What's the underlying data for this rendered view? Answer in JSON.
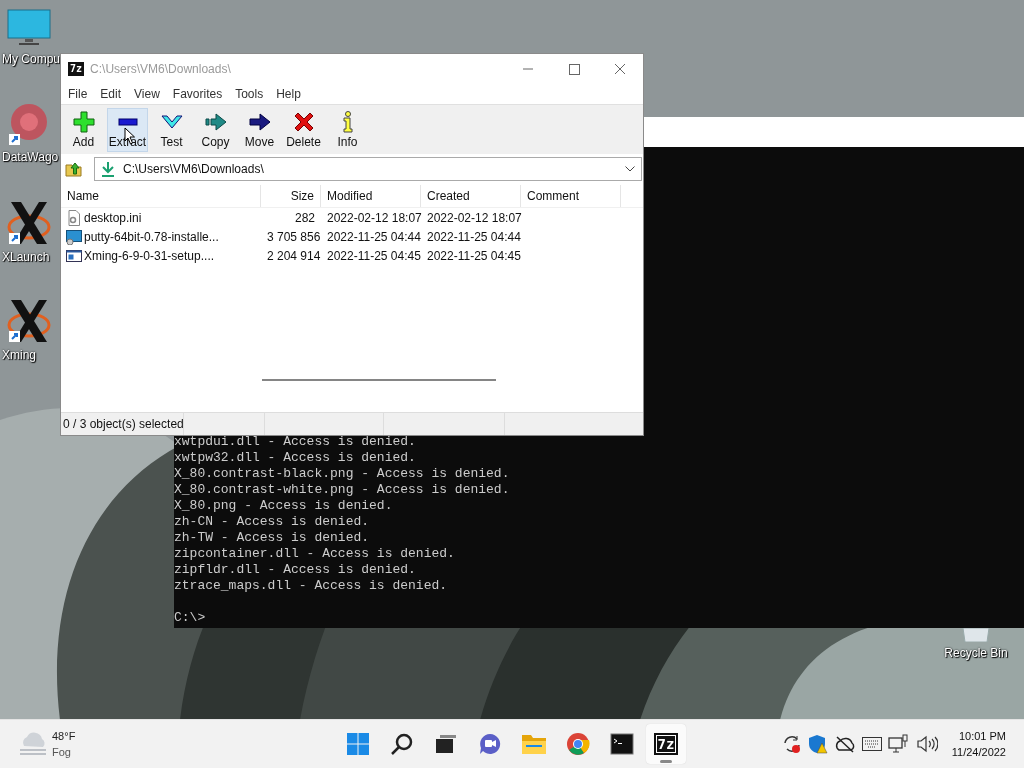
{
  "desktop_icons": [
    {
      "label": "My Compu",
      "kind": "monitor"
    },
    {
      "label": "DataWago",
      "kind": "network"
    },
    {
      "label": "XLaunch",
      "kind": "x"
    },
    {
      "label": "Xming",
      "kind": "x"
    },
    {
      "label": "Recycle Bin",
      "kind": "bin"
    }
  ],
  "console": {
    "lines": [
      "xwtpdui.dll - Access is denied.",
      "xwtpw32.dll - Access is denied.",
      "X_80.contrast-black.png - Access is denied.",
      "X_80.contrast-white.png - Access is denied.",
      "X_80.png - Access is denied.",
      "zh-CN - Access is denied.",
      "zh-TW - Access is denied.",
      "zipcontainer.dll - Access is denied.",
      "zipfldr.dll - Access is denied.",
      "ztrace_maps.dll - Access is denied."
    ],
    "prompt": "C:\\>"
  },
  "window": {
    "logo": "7z",
    "title": "C:\\Users\\VM6\\Downloads\\",
    "menu": [
      "File",
      "Edit",
      "View",
      "Favorites",
      "Tools",
      "Help"
    ],
    "toolbar": [
      {
        "label": "Add",
        "kind": "add",
        "highlighted": false
      },
      {
        "label": "Extract",
        "kind": "extract",
        "highlighted": true
      },
      {
        "label": "Test",
        "kind": "test",
        "highlighted": false
      },
      {
        "label": "Copy",
        "kind": "copy",
        "highlighted": false
      },
      {
        "label": "Move",
        "kind": "move",
        "highlighted": false
      },
      {
        "label": "Delete",
        "kind": "delete",
        "highlighted": false
      },
      {
        "label": "Info",
        "kind": "info",
        "highlighted": false
      }
    ],
    "address": "C:\\Users\\VM6\\Downloads\\",
    "columns": [
      "Name",
      "Size",
      "Modified",
      "Created",
      "Comment"
    ],
    "rows": [
      {
        "kind": "settings",
        "name": "desktop.ini",
        "size": "282",
        "modified": "2022-02-12 18:07",
        "created": "2022-02-12 18:07"
      },
      {
        "kind": "installer",
        "name": "putty-64bit-0.78-installe...",
        "size": "3 705 856",
        "modified": "2022-11-25 04:44",
        "created": "2022-11-25 04:44"
      },
      {
        "kind": "program",
        "name": "Xming-6-9-0-31-setup....",
        "size": "2 204 914",
        "modified": "2022-11-25 04:45",
        "created": "2022-11-25 04:45"
      }
    ],
    "status": "0 / 3 object(s) selected"
  },
  "taskbar": {
    "weather": {
      "temperature": "48°F",
      "condition": "Fog"
    },
    "apps": [
      {
        "kind": "start",
        "active": false
      },
      {
        "kind": "search",
        "active": false
      },
      {
        "kind": "taskview",
        "active": false
      },
      {
        "kind": "chat",
        "active": false
      },
      {
        "kind": "explorer",
        "active": false
      },
      {
        "kind": "browser",
        "active": false
      },
      {
        "kind": "terminal",
        "active": false
      },
      {
        "kind": "sevenzip",
        "label": "7z",
        "active": true
      }
    ],
    "tray": [
      {
        "kind": "sync"
      },
      {
        "kind": "security"
      },
      {
        "kind": "cloud"
      },
      {
        "kind": "keyboard"
      },
      {
        "kind": "network"
      },
      {
        "kind": "volume"
      }
    ],
    "time": "10:01 PM",
    "date": "11/24/2022"
  }
}
